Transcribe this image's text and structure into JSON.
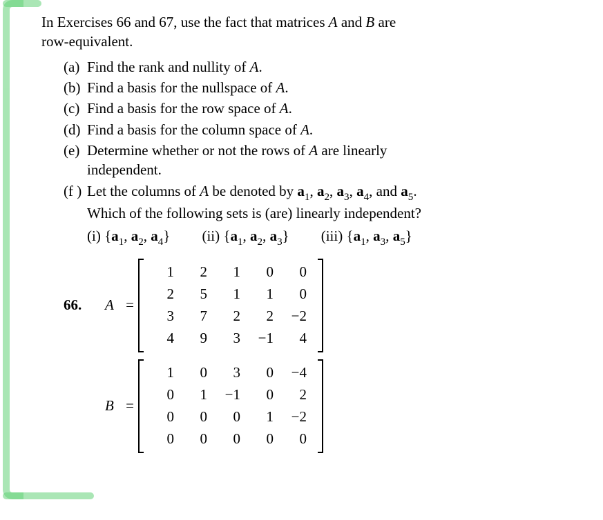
{
  "intro_line1": "In Exercises 66 and 67, use the fact that matrices ",
  "intro_A": "A",
  "intro_and": " and ",
  "intro_B": "B",
  "intro_line1_end": " are",
  "intro_line2": "row-equivalent.",
  "parts": {
    "a": {
      "label": "(a)",
      "text_pre": "Find the rank and nullity of ",
      "ital": "A",
      "post": "."
    },
    "b": {
      "label": "(b)",
      "text_pre": "Find a basis for the nullspace of ",
      "ital": "A",
      "post": "."
    },
    "c": {
      "label": "(c)",
      "text_pre": "Find a basis for the row space of ",
      "ital": "A",
      "post": "."
    },
    "d": {
      "label": "(d)",
      "text_pre": "Find a basis for the column space of ",
      "ital": "A",
      "post": "."
    },
    "e": {
      "label": "(e)",
      "line1_pre": "Determine  whether  or  not  the  rows  of ",
      "ital": "A",
      "line1_post": "  are  linearly",
      "line2": "independent."
    },
    "f": {
      "label": "(f )",
      "l1_pre": "Let the columns of ",
      "ital": "A",
      "l1_mid": " be denoted by ",
      "a1": "a",
      "s1": "1",
      "c1": ", ",
      "a2": "a",
      "s2": "2",
      "c2": ", ",
      "a3": "a",
      "s3": "3",
      "c3": ", ",
      "a4": "a",
      "s4": "4",
      "c4": ", and ",
      "a5": "a",
      "s5": "5",
      "dot": ".",
      "l2": "Which of the following sets is (are) linearly independent?"
    }
  },
  "sets": {
    "i": {
      "label": "(i)",
      "open": "  {",
      "a1": "a",
      "s1": "1",
      "c1": ", ",
      "a2": "a",
      "s2": "2",
      "c2": ", ",
      "a3": "a",
      "s3": "4",
      "close": "}"
    },
    "ii": {
      "label": "(ii)",
      "open": "  {",
      "a1": "a",
      "s1": "1",
      "c1": ", ",
      "a2": "a",
      "s2": "2",
      "c2": ", ",
      "a3": "a",
      "s3": "3",
      "close": "}"
    },
    "iii": {
      "label": "(iii)",
      "open": "  {",
      "a1": "a",
      "s1": "1",
      "c1": ", ",
      "a2": "a",
      "s2": "3",
      "c2": ", ",
      "a3": "a",
      "s3": "5",
      "close": "}"
    }
  },
  "problem": {
    "num": "66.",
    "A_label": "A",
    "B_label": "B",
    "eq": "="
  },
  "matrixA": [
    [
      "1",
      "2",
      "1",
      "0",
      "0"
    ],
    [
      "2",
      "5",
      "1",
      "1",
      "0"
    ],
    [
      "3",
      "7",
      "2",
      "2",
      "−2"
    ],
    [
      "4",
      "9",
      "3",
      "−1",
      "4"
    ]
  ],
  "matrixB": [
    [
      "1",
      "0",
      "3",
      "0",
      "−4"
    ],
    [
      "0",
      "1",
      "−1",
      "0",
      "2"
    ],
    [
      "0",
      "0",
      "0",
      "1",
      "−2"
    ],
    [
      "0",
      "0",
      "0",
      "0",
      "0"
    ]
  ]
}
